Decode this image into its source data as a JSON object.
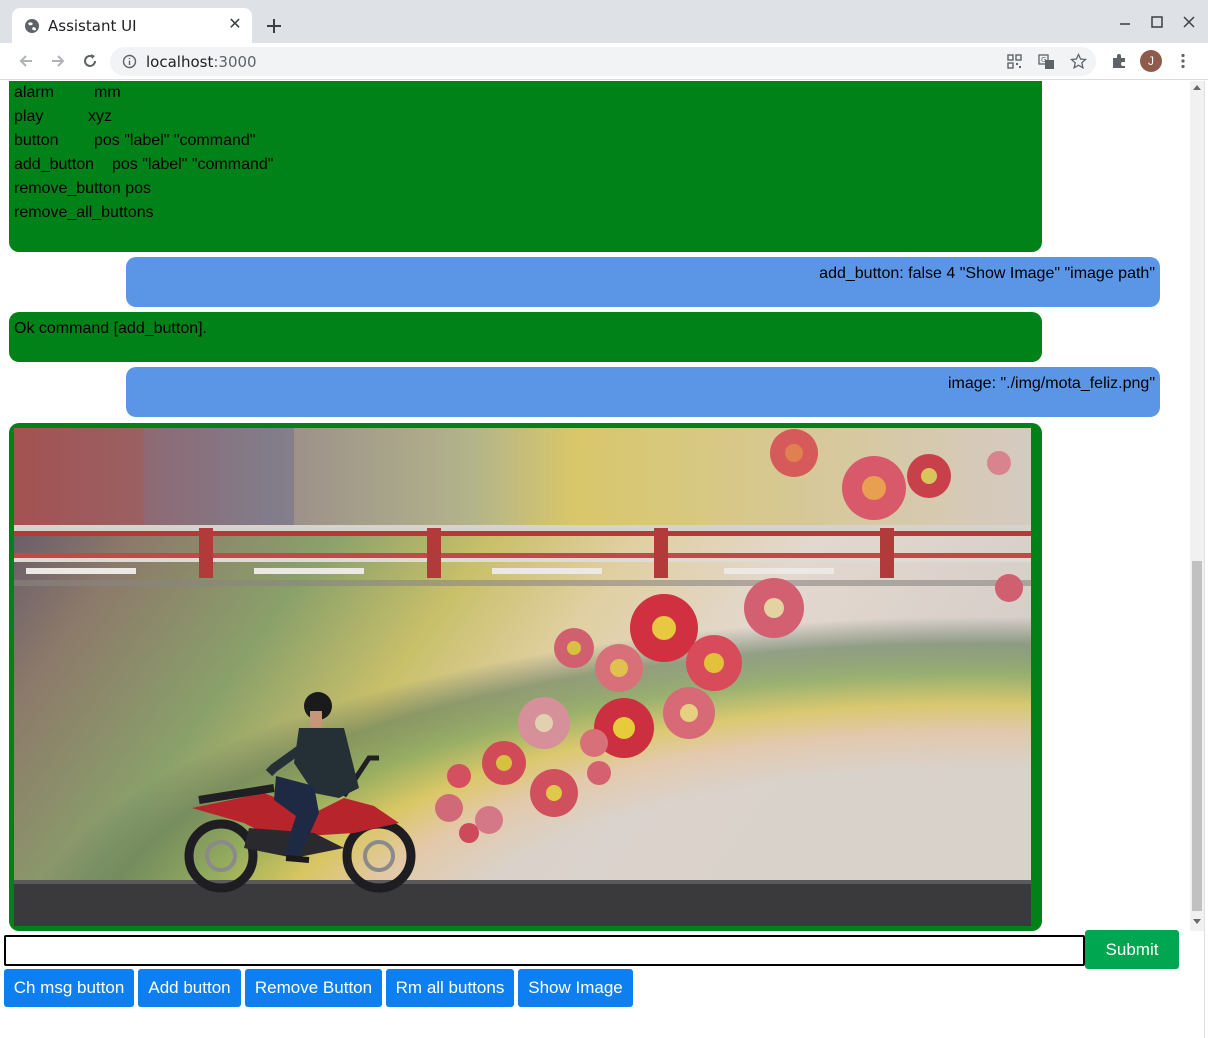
{
  "browser": {
    "tab_title": "Assistant UI",
    "url_host": "localhost",
    "url_port": ":3000",
    "profile_initial": "J"
  },
  "chat": {
    "help_rows": [
      {
        "cmd": "alarm",
        "args": "mm"
      },
      {
        "cmd": "play",
        "args": "xyz"
      },
      {
        "cmd": "button",
        "args": "pos \"label\" \"command\""
      },
      {
        "cmd": "add_button",
        "args": "pos \"label\" \"command\""
      },
      {
        "cmd": "remove_button",
        "args": "pos"
      },
      {
        "cmd": "remove_all_buttons",
        "args": ""
      }
    ],
    "messages": [
      {
        "from": "user",
        "text": "add_button: false 4 \"Show Image\" \"image path\""
      },
      {
        "from": "bot",
        "text": "Ok command [add_button]."
      },
      {
        "from": "user",
        "text": "image: \"./img/mota_feliz.png\""
      }
    ]
  },
  "input": {
    "value": "",
    "submit_label": "Submit"
  },
  "buttons": [
    "Ch msg button",
    "Add button",
    "Remove Button",
    "Rm all buttons",
    "Show Image"
  ],
  "colors": {
    "bot_bubble": "#008218",
    "user_bubble": "#5b96e6",
    "submit": "#00a650",
    "command_button": "#0d7ff0"
  }
}
